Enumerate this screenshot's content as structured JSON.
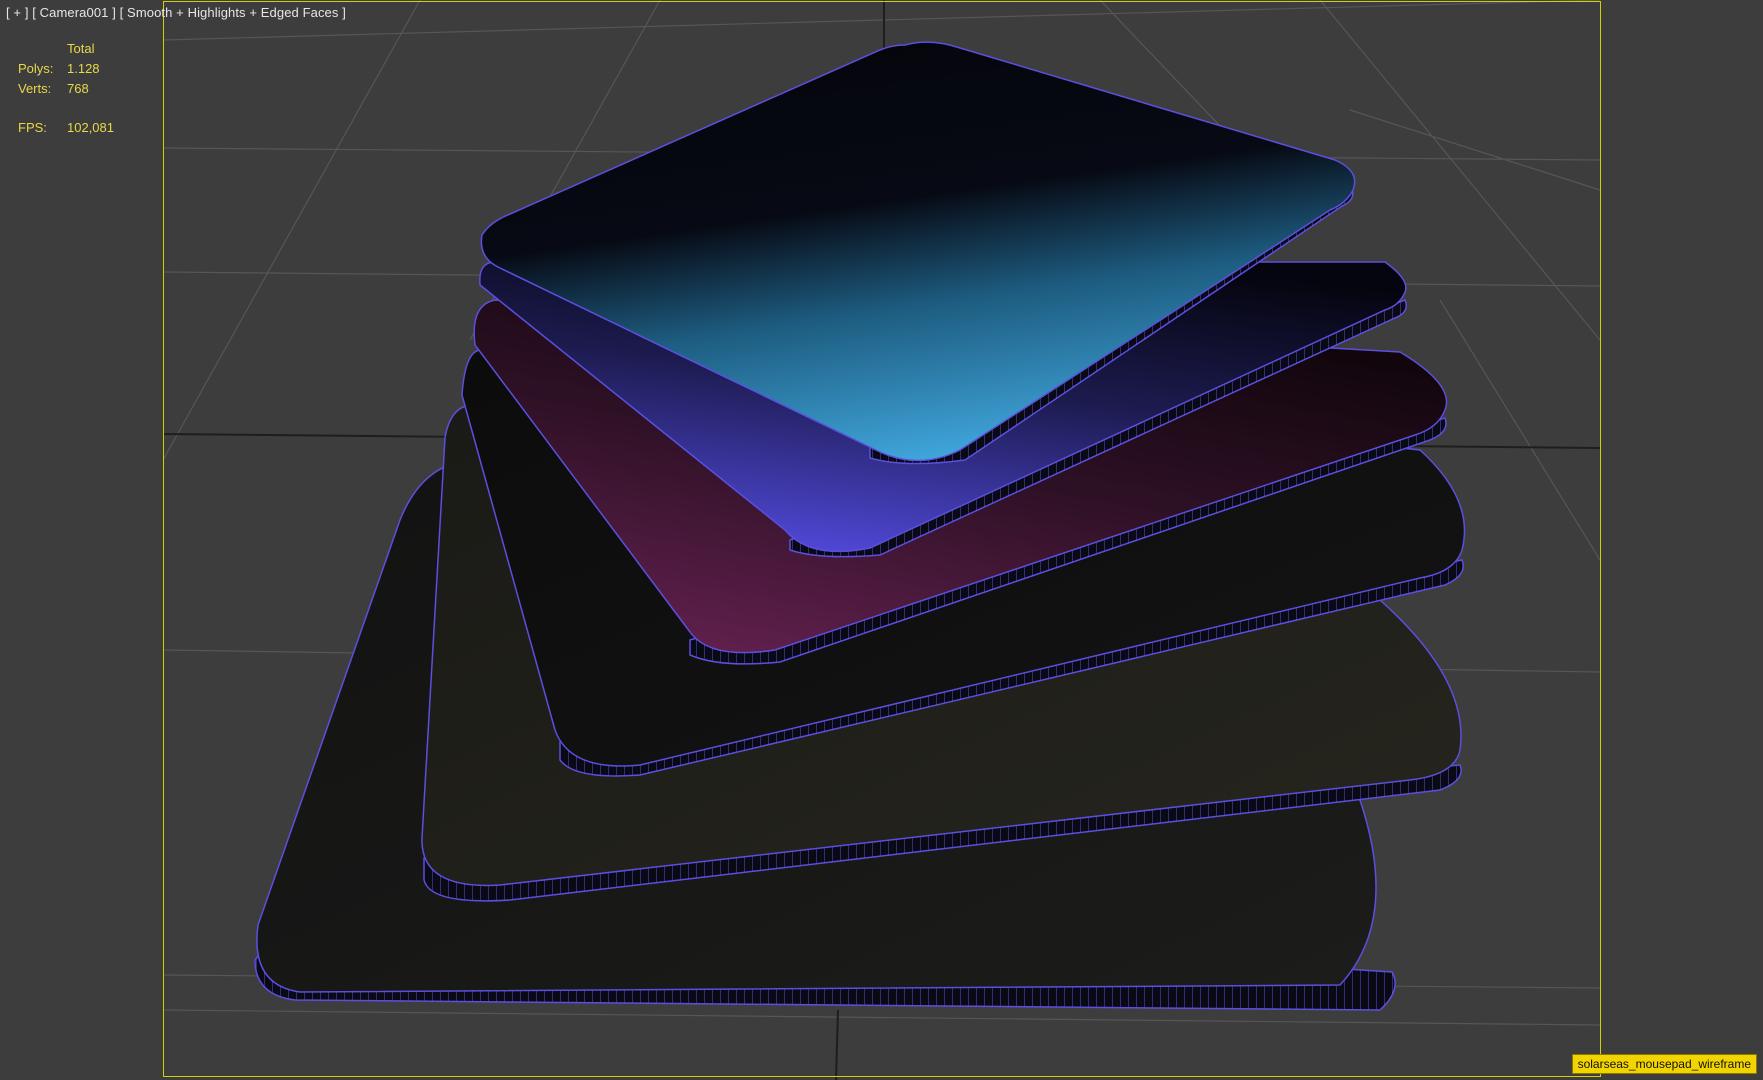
{
  "viewport": {
    "label": "[ + ] [ Camera001 ] [ Smooth + Highlights + Edged Faces ]"
  },
  "stats": {
    "header": "Total",
    "polys_label": "Polys:",
    "polys_value": "1.128",
    "verts_label": "Verts:",
    "verts_value": "768",
    "fps_label": "FPS:",
    "fps_value": "102,081"
  },
  "file_tag": "solarseas_mousepad_wireframe",
  "colors": {
    "background": "#3d3d3d",
    "grid": "#5a5a5a",
    "grid_axis": "#1c1c1c",
    "safe_frame": "#d4d000",
    "stats_text": "#e8d84a",
    "wire_edge": "#5b4fe0",
    "pad_cyan": "#3fa6e0",
    "pad_blue": "#4f46d8",
    "pad_magenta": "#6a2456"
  }
}
